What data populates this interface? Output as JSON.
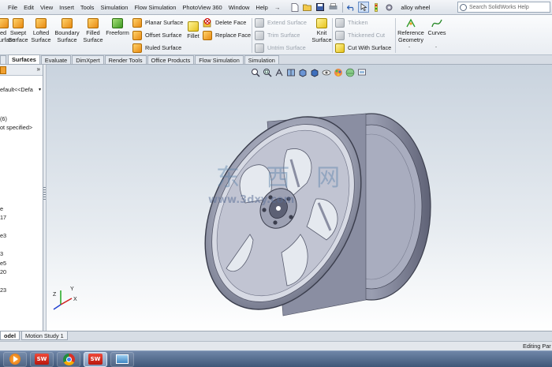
{
  "menu": {
    "items": [
      "File",
      "Edit",
      "View",
      "Insert",
      "Tools",
      "Simulation",
      "Flow Simulation",
      "PhotoView 360",
      "Window",
      "Help"
    ],
    "pin": "→"
  },
  "quick_access": {
    "icons": [
      "new-document-icon",
      "open-icon",
      "save-icon",
      "print-icon",
      "undo-icon",
      "select-icon",
      "rebuild-icon",
      "options-icon"
    ]
  },
  "document_title": "alloy wheel",
  "help_search": {
    "placeholder": "Search SolidWorks Help"
  },
  "ribbon": {
    "big_buttons": [
      {
        "label": "ed\nSurface",
        "icon": "extruded-surface-icon"
      },
      {
        "label": "Swept\nSurface",
        "icon": "swept-surface-icon"
      },
      {
        "label": "Lofted\nSurface",
        "icon": "lofted-surface-icon"
      },
      {
        "label": "Boundary\nSurface",
        "icon": "boundary-surface-icon"
      },
      {
        "label": "Filled\nSurface",
        "icon": "filled-surface-icon"
      },
      {
        "label": "Freeform",
        "icon": "freeform-icon"
      }
    ],
    "surface_col": [
      "Planar Surface",
      "Offset Surface",
      "Ruled Surface"
    ],
    "fillet": "Fillet",
    "face_col": [
      "Delete Face",
      "Replace Face"
    ],
    "edit_col": [
      "Extend Surface",
      "Trim Surface",
      "Untrim Surface"
    ],
    "knit": "Knit\nSurface",
    "thicken_col": [
      "Thicken",
      "Thickened Cut",
      "Cut With Surface"
    ],
    "reference_geometry": "Reference\nGeometry",
    "curves": "Curves",
    "dropdown_marker": "-"
  },
  "tabs": [
    "Surfaces",
    "Evaluate",
    "DimXpert",
    "Render Tools",
    "Office Products",
    "Flow Simulation",
    "Simulation"
  ],
  "active_tab": "Surfaces",
  "feature_tree": {
    "lines": [
      "efault<<Defa",
      "(6)",
      "ot specified>",
      "e",
      "17",
      "e3",
      "3",
      "e5",
      "20",
      "23"
    ],
    "collapse_glyph": "»"
  },
  "heads_up_toolbar": {
    "icons": [
      "zoom-to-fit-icon",
      "zoom-to-area-icon",
      "previous-view-icon",
      "section-view-icon",
      "view-orientation-icon",
      "display-style-icon",
      "hide-show-items-icon",
      "edit-appearance-icon",
      "apply-scene-icon",
      "view-settings-icon"
    ]
  },
  "triad": {
    "x": "X",
    "y": "Y",
    "z": "Z"
  },
  "watermark": "东 西 网",
  "watermark_url": "www.3dxy.com",
  "bottom_tabs": [
    "odel",
    "Motion Study 1"
  ],
  "status": {
    "text": "Editing Par"
  },
  "taskbar": {
    "icons": [
      "media-player-icon",
      "solidworks-icon",
      "chrome-icon",
      "solidworks-icon",
      "image-viewer-icon"
    ],
    "sw_label": "SW"
  },
  "colors": {
    "wheel_light": "#b9bccb",
    "wheel_mid": "#8b8fa3",
    "wheel_dark": "#4a4d5e",
    "accent": "#e88a12"
  }
}
